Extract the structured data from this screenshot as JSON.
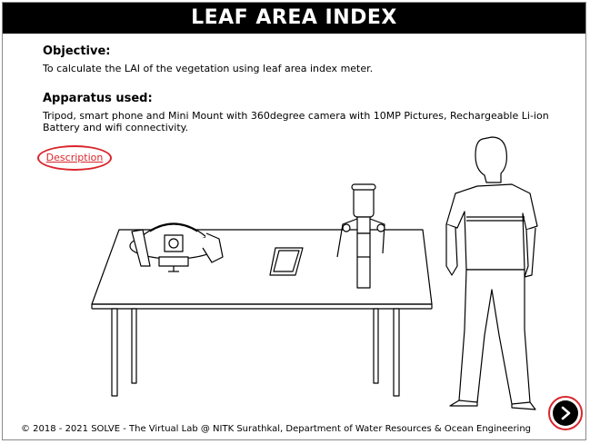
{
  "header": {
    "title": "LEAF AREA INDEX"
  },
  "objective": {
    "heading": "Objective:",
    "text": "To calculate the LAI of the vegetation using leaf area index meter."
  },
  "apparatus": {
    "heading": "Apparatus used:",
    "text": "Tripod, smart phone and Mini Mount with 360degree camera with 10MP Pictures, Rechargeable Li-ion Battery and wifi connectivity."
  },
  "description_link": {
    "label": "Description"
  },
  "footer": {
    "text": "© 2018 - 2021 SOLVE - The Virtual Lab @ NITK Surathkal, Department of Water Resources & Ocean Engineering"
  },
  "navigation": {
    "next_icon": "chevron-right-icon"
  },
  "colors": {
    "accent_red": "#d9252b",
    "title_bg": "#000000",
    "title_fg": "#ffffff"
  }
}
